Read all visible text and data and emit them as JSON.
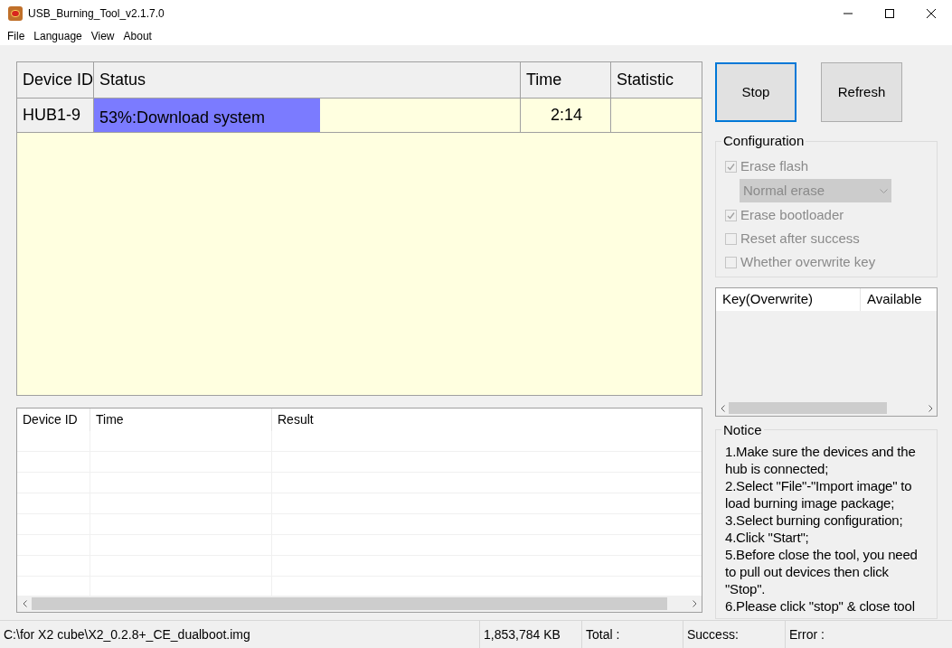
{
  "window": {
    "title": "USB_Burning_Tool_v2.1.7.0"
  },
  "menu": [
    "File",
    "Language",
    "View",
    "About"
  ],
  "device_table": {
    "columns": [
      "Device ID",
      "Status",
      "Time",
      "Statistic"
    ],
    "rows": [
      {
        "device_id": "HUB1-9",
        "status": "53%:Download system",
        "level": 0.53,
        "time": "2:14",
        "statistic": ""
      }
    ]
  },
  "result_table": {
    "columns": [
      "Device ID",
      "Time",
      "Result"
    ]
  },
  "buttons": [
    {
      "label": "Stop",
      "focused": true
    },
    {
      "label": "Refresh",
      "focused": false
    }
  ],
  "configuration": {
    "title": "Configuration",
    "items": [
      {
        "kind": "checkbox",
        "label": "Erase flash",
        "checked": true,
        "disabled": true
      },
      {
        "kind": "dropdown",
        "value": "Normal erase",
        "disabled": true
      },
      {
        "kind": "checkbox",
        "label": "Erase bootloader",
        "checked": true,
        "disabled": true
      },
      {
        "kind": "checkbox",
        "label": "Reset after success",
        "checked": false,
        "disabled": true
      },
      {
        "kind": "checkbox",
        "label": "Whether overwrite key",
        "checked": false,
        "disabled": true
      }
    ]
  },
  "key_table": {
    "columns": [
      "Key(Overwrite)",
      "Available"
    ]
  },
  "notice": {
    "title": "Notice",
    "lines": [
      "1.Make sure the devices and the hub is connected;",
      "2.Select \"File\"-\"Import image\" to load burning image package;",
      "3.Select burning configuration;",
      "4.Click \"Start\";",
      "5.Before close the tool, you need to pull out devices then click \"Stop\".",
      "6.Please click \"stop\" & close tool"
    ]
  },
  "status_bar": [
    "C:\\for X2 cube\\X2_0.2.8+_CE_dualboot.img",
    "1,853,784 KB",
    "Total :",
    "Success:",
    "Error :"
  ]
}
